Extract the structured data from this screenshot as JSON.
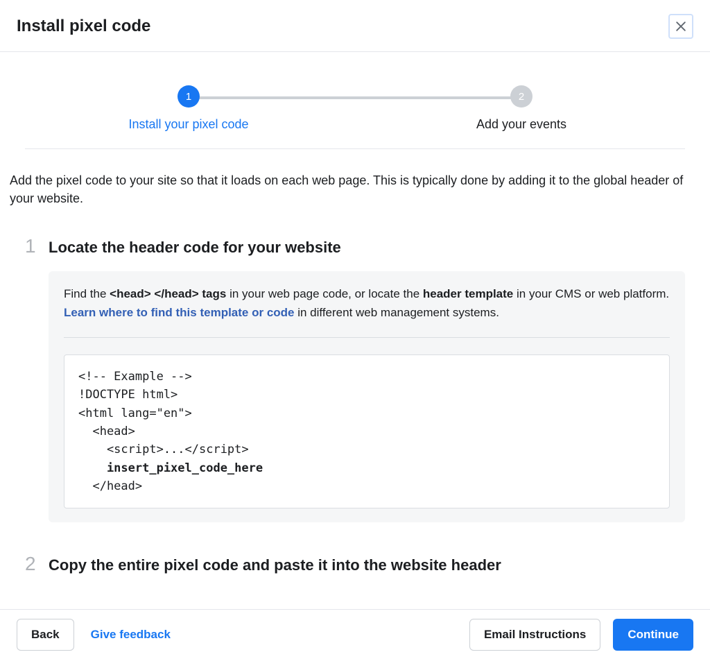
{
  "header": {
    "title": "Install pixel code"
  },
  "stepper": {
    "step1": {
      "num": "1",
      "label": "Install your pixel code"
    },
    "step2": {
      "num": "2",
      "label": "Add your events"
    }
  },
  "intro": "Add the pixel code to your site so that it loads on each web page. This is typically done by adding it to the global header of your website.",
  "section1": {
    "num": "1",
    "title": "Locate the header code for your website",
    "desc_pre": "Find the ",
    "desc_tags": "<head> </head> tags",
    "desc_mid1": " in your web page code, or locate the ",
    "desc_bold2": "header template",
    "desc_mid2": " in your CMS or web platform. ",
    "desc_link": "Learn where to find this template or code",
    "desc_post": " in different web management systems.",
    "code_l1": "<!-- Example -->",
    "code_l2": "!DOCTYPE html>",
    "code_l3": "<html lang=\"en\">",
    "code_l4": "  <head>",
    "code_l5": "    <script>...</script>",
    "code_l6": "    insert_pixel_code_here",
    "code_l7": "  </head>"
  },
  "section2": {
    "num": "2",
    "title": "Copy the entire pixel code and paste it into the website header"
  },
  "footer": {
    "back": "Back",
    "feedback": "Give feedback",
    "email": "Email Instructions",
    "continue": "Continue"
  }
}
